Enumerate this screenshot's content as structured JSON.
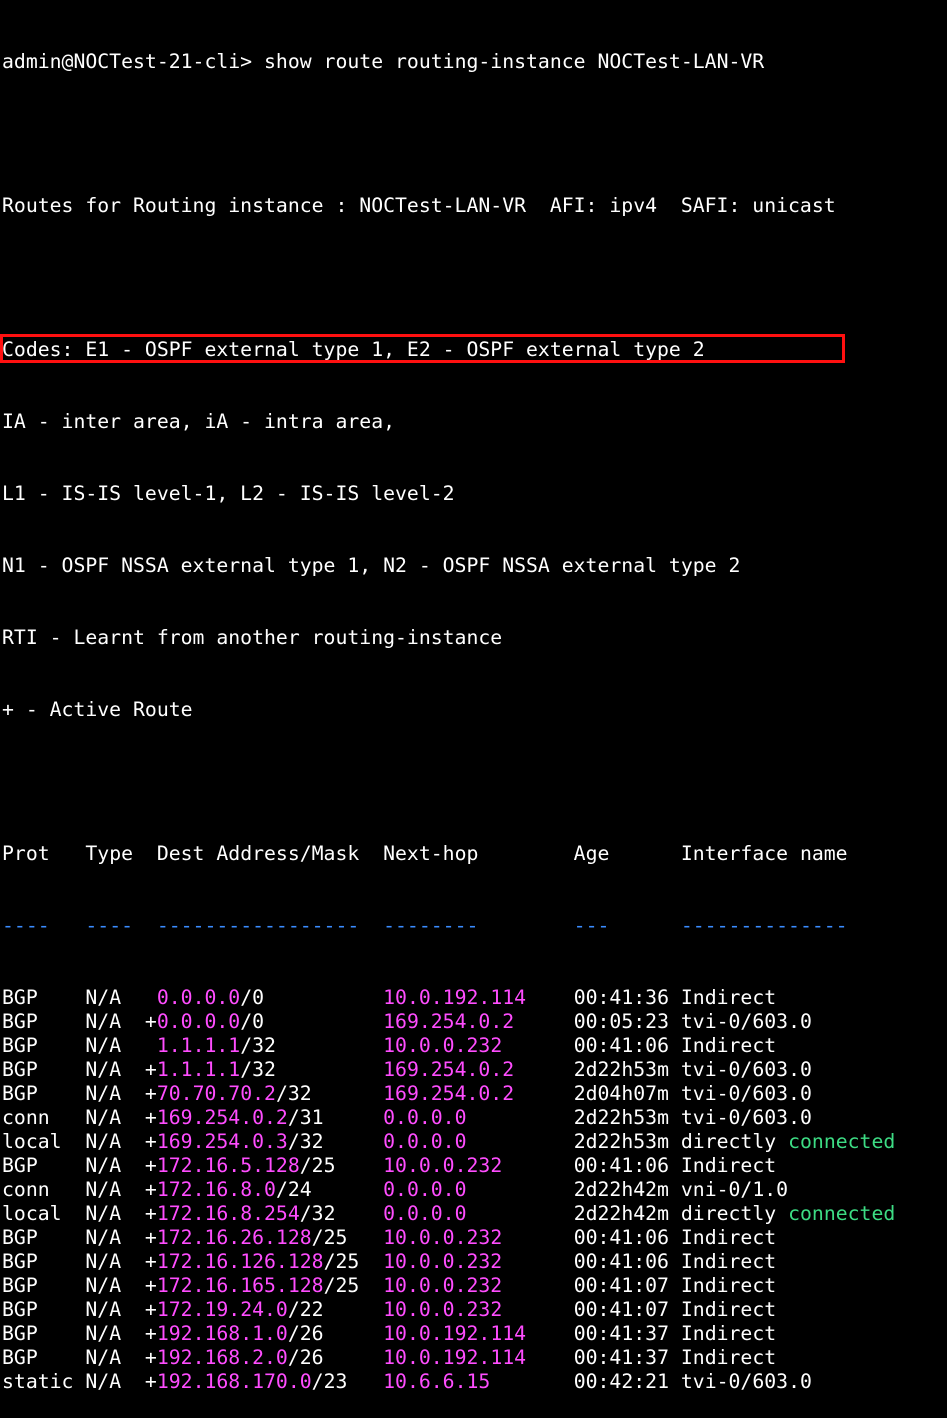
{
  "terminal": {
    "prompt": "admin@NOCTest-21-cli> ",
    "command": "show route routing-instance NOCTest-LAN-VR",
    "routes_header": "Routes for Routing instance : NOCTest-LAN-VR  AFI: ipv4  SAFI: unicast",
    "codes": [
      "Codes: E1 - OSPF external type 1, E2 - OSPF external type 2",
      "IA - inter area, iA - intra area,",
      "L1 - IS-IS level-1, L2 - IS-IS level-2",
      "N1 - OSPF NSSA external type 1, N2 - OSPF NSSA external type 2",
      "RTI - Learnt from another routing-instance",
      "+ - Active Route"
    ]
  },
  "table": {
    "headers": {
      "prot": "Prot",
      "type": "Type",
      "dest": "Dest Address/Mask",
      "nexthop": "Next-hop",
      "age": "Age",
      "iface": "Interface name"
    },
    "underlines": {
      "prot": "----",
      "type": "----",
      "dest": "-----------------",
      "nexthop": "--------",
      "age": "---",
      "iface": "--------------"
    },
    "rows": [
      {
        "prot": "BGP",
        "type": "N/A",
        "flag": " ",
        "ip": "0.0.0.0",
        "mask": "/0",
        "nexthop": "10.0.192.114",
        "age": "00:41:36",
        "iface": "Indirect",
        "iface_extra": ""
      },
      {
        "prot": "BGP",
        "type": "N/A",
        "flag": "+",
        "ip": "0.0.0.0",
        "mask": "/0",
        "nexthop": "169.254.0.2",
        "age": "00:05:23",
        "iface": "tvi-0/603.0",
        "iface_extra": ""
      },
      {
        "prot": "BGP",
        "type": "N/A",
        "flag": " ",
        "ip": "1.1.1.1",
        "mask": "/32",
        "nexthop": "10.0.0.232",
        "age": "00:41:06",
        "iface": "Indirect",
        "iface_extra": ""
      },
      {
        "prot": "BGP",
        "type": "N/A",
        "flag": "+",
        "ip": "1.1.1.1",
        "mask": "/32",
        "nexthop": "169.254.0.2",
        "age": "2d22h53m",
        "iface": "tvi-0/603.0",
        "iface_extra": ""
      },
      {
        "prot": "BGP",
        "type": "N/A",
        "flag": "+",
        "ip": "70.70.70.2",
        "mask": "/32",
        "nexthop": "169.254.0.2",
        "age": "2d04h07m",
        "iface": "tvi-0/603.0",
        "iface_extra": ""
      },
      {
        "prot": "conn",
        "type": "N/A",
        "flag": "+",
        "ip": "169.254.0.2",
        "mask": "/31",
        "nexthop": "0.0.0.0",
        "age": "2d22h53m",
        "iface": "tvi-0/603.0",
        "iface_extra": ""
      },
      {
        "prot": "local",
        "type": "N/A",
        "flag": "+",
        "ip": "169.254.0.3",
        "mask": "/32",
        "nexthop": "0.0.0.0",
        "age": "2d22h53m",
        "iface": "directly",
        "iface_extra": "connected"
      },
      {
        "prot": "BGP",
        "type": "N/A",
        "flag": "+",
        "ip": "172.16.5.128",
        "mask": "/25",
        "nexthop": "10.0.0.232",
        "age": "00:41:06",
        "iface": "Indirect",
        "iface_extra": ""
      },
      {
        "prot": "conn",
        "type": "N/A",
        "flag": "+",
        "ip": "172.16.8.0",
        "mask": "/24",
        "nexthop": "0.0.0.0",
        "age": "2d22h42m",
        "iface": "vni-0/1.0",
        "iface_extra": ""
      },
      {
        "prot": "local",
        "type": "N/A",
        "flag": "+",
        "ip": "172.16.8.254",
        "mask": "/32",
        "nexthop": "0.0.0.0",
        "age": "2d22h42m",
        "iface": "directly",
        "iface_extra": "connected"
      },
      {
        "prot": "BGP",
        "type": "N/A",
        "flag": "+",
        "ip": "172.16.26.128",
        "mask": "/25",
        "nexthop": "10.0.0.232",
        "age": "00:41:06",
        "iface": "Indirect",
        "iface_extra": ""
      },
      {
        "prot": "BGP",
        "type": "N/A",
        "flag": "+",
        "ip": "172.16.126.128",
        "mask": "/25",
        "nexthop": "10.0.0.232",
        "age": "00:41:06",
        "iface": "Indirect",
        "iface_extra": ""
      },
      {
        "prot": "BGP",
        "type": "N/A",
        "flag": "+",
        "ip": "172.16.165.128",
        "mask": "/25",
        "nexthop": "10.0.0.232",
        "age": "00:41:07",
        "iface": "Indirect",
        "iface_extra": ""
      },
      {
        "prot": "BGP",
        "type": "N/A",
        "flag": "+",
        "ip": "172.19.24.0",
        "mask": "/22",
        "nexthop": "10.0.0.232",
        "age": "00:41:07",
        "iface": "Indirect",
        "iface_extra": ""
      },
      {
        "prot": "BGP",
        "type": "N/A",
        "flag": "+",
        "ip": "192.168.1.0",
        "mask": "/26",
        "nexthop": "10.0.192.114",
        "age": "00:41:37",
        "iface": "Indirect",
        "iface_extra": ""
      },
      {
        "prot": "BGP",
        "type": "N/A",
        "flag": "+",
        "ip": "192.168.2.0",
        "mask": "/26",
        "nexthop": "10.0.192.114",
        "age": "00:41:37",
        "iface": "Indirect",
        "iface_extra": ""
      },
      {
        "prot": "static",
        "type": "N/A",
        "flag": "+",
        "ip": "192.168.170.0",
        "mask": "/23",
        "nexthop": "10.6.6.15",
        "age": "00:42:21",
        "iface": "tvi-0/603.0",
        "iface_extra": ""
      }
    ]
  },
  "colors": {
    "background": "#000000",
    "text": "#ffffff",
    "address_highlight": "#ff4dff",
    "connected": "#3ddc84",
    "header_dashes": "#3a8cff",
    "selection_box": "#ff1010"
  },
  "highlight": {
    "label": "selected route row",
    "row_index": 1
  }
}
